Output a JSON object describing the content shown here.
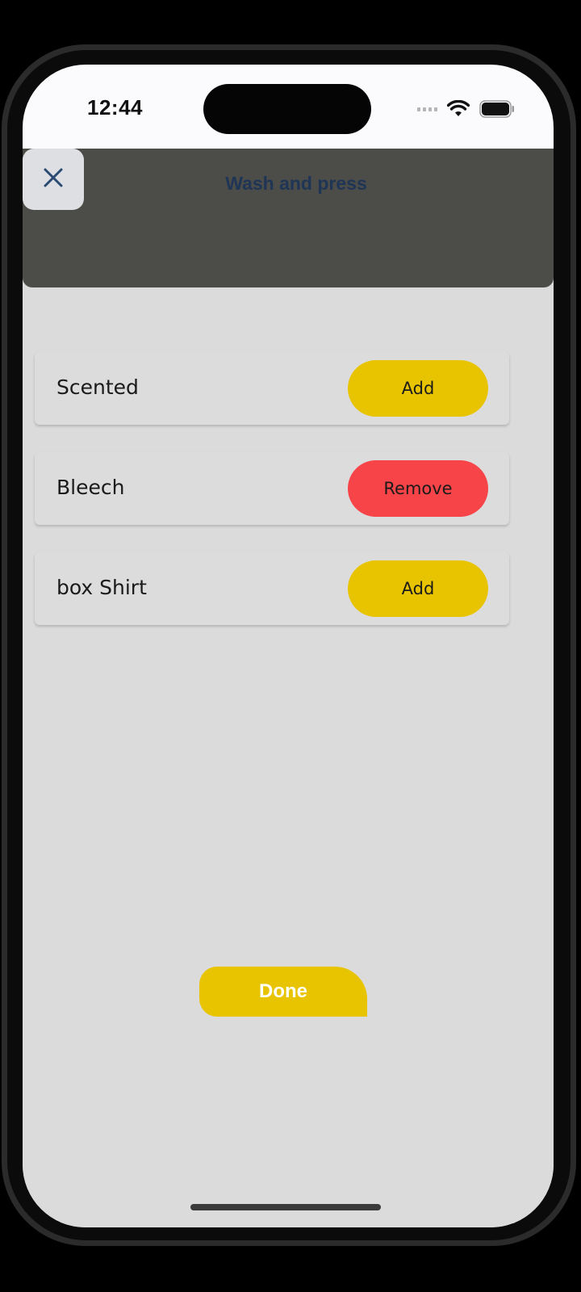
{
  "status_bar": {
    "time": "12:44"
  },
  "header": {
    "title": "Wash and press",
    "close_icon": "close-icon"
  },
  "options": [
    {
      "label": "Scented",
      "action": "Add",
      "action_color": "#e8c400"
    },
    {
      "label": "Bleech",
      "action": "Remove",
      "action_color": "#f74448"
    },
    {
      "label": "box Shirt",
      "action": "Add",
      "action_color": "#e8c400"
    }
  ],
  "done_button": {
    "label": "Done",
    "color": "#e8c400"
  },
  "colors": {
    "header_bg": "#4c4c48",
    "content_bg": "#dbdbdc",
    "title": "#1f3556"
  }
}
